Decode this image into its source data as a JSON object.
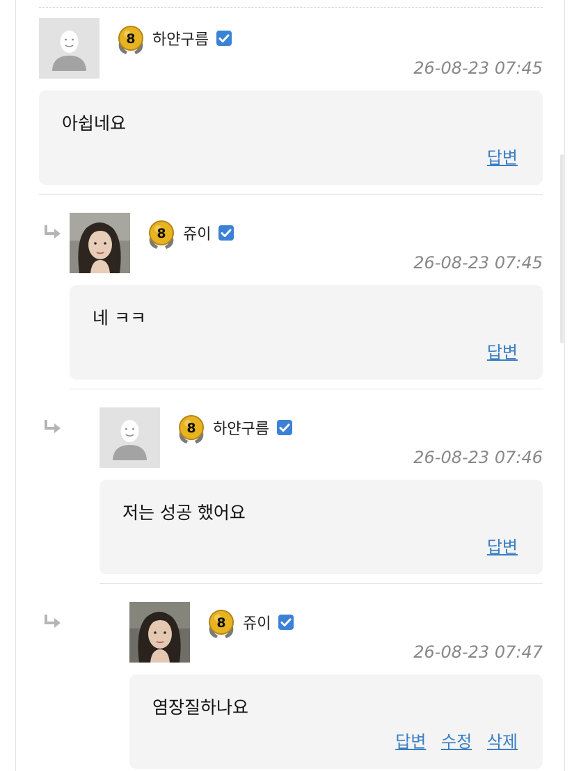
{
  "colors": {
    "link": "#3a7ec4",
    "timestamp": "#888888",
    "bubble_bg": "#f4f4f4",
    "verified": "#3b82d6",
    "badge_gold": "#e7b321"
  },
  "comments": [
    {
      "nickname": "하얀구름",
      "timestamp": "26-08-23 07:45",
      "content": "아쉽네요",
      "avatar": "default-avatar",
      "badge_level": "8",
      "actions": {
        "reply": "답변"
      }
    },
    {
      "nickname": "쥬이",
      "timestamp": "26-08-23 07:45",
      "content": "네 ㅋㅋ",
      "avatar": "photo-avatar",
      "badge_level": "8",
      "actions": {
        "reply": "답변"
      }
    },
    {
      "nickname": "하얀구름",
      "timestamp": "26-08-23 07:46",
      "content": "저는 성공 했어요",
      "avatar": "default-avatar",
      "badge_level": "8",
      "actions": {
        "reply": "답변"
      }
    },
    {
      "nickname": "쥬이",
      "timestamp": "26-08-23 07:47",
      "content": "염장질하나요",
      "avatar": "photo-avatar",
      "badge_level": "8",
      "actions": {
        "reply": "답변",
        "edit": "수정",
        "delete": "삭제"
      }
    }
  ]
}
